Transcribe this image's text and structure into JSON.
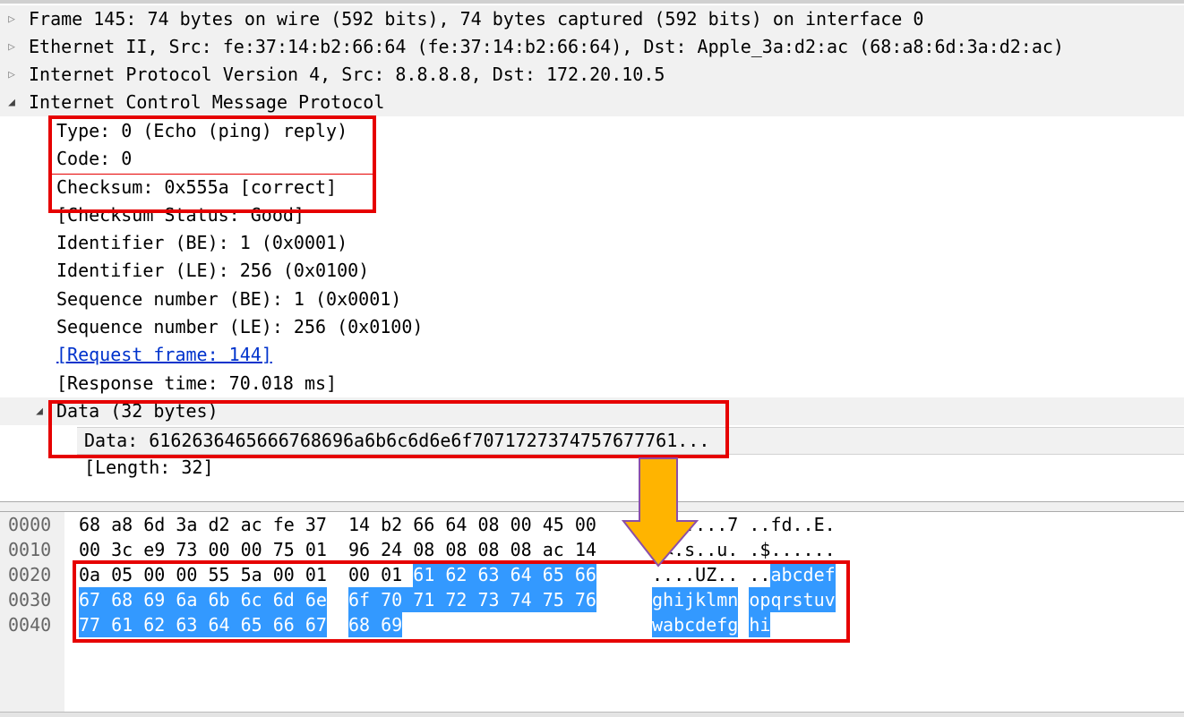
{
  "detail_tree": {
    "frame": "Frame 145: 74 bytes on wire (592 bits), 74 bytes captured (592 bits) on interface 0",
    "ethernet": "Ethernet II, Src: fe:37:14:b2:66:64 (fe:37:14:b2:66:64), Dst: Apple_3a:d2:ac (68:a8:6d:3a:d2:ac)",
    "ip": "Internet Protocol Version 4, Src: 8.8.8.8, Dst: 172.20.10.5",
    "icmp": "Internet Control Message Protocol",
    "type": "Type: 0 (Echo (ping) reply)",
    "code": "Code: 0",
    "checksum": "Checksum: 0x555a [correct]",
    "checksum_status": "[Checksum Status: Good]",
    "id_be": "Identifier (BE): 1 (0x0001)",
    "id_le": "Identifier (LE): 256 (0x0100)",
    "seq_be": "Sequence number (BE): 1 (0x0001)",
    "seq_le": "Sequence number (LE): 256 (0x0100)",
    "request_frame": "[Request frame: 144]",
    "response_time": "[Response time: 70.018 ms]",
    "data_header": "Data (32 bytes)",
    "data_value": "Data: 6162636465666768696a6b6c6d6e6f7071727374757677761...",
    "length": "[Length: 32]"
  },
  "hex_pane": {
    "rows": [
      {
        "offset": "0000",
        "bytes": [
          "68",
          "a8",
          "6d",
          "3a",
          "d2",
          "ac",
          "fe",
          "37",
          "14",
          "b2",
          "66",
          "64",
          "08",
          "00",
          "45",
          "00"
        ],
        "ascii": [
          "h",
          ".",
          "m",
          ":",
          ".",
          ".",
          ".",
          "7",
          ".",
          ".",
          "f",
          "d",
          ".",
          ".",
          "E",
          "."
        ],
        "sel_from": 99
      },
      {
        "offset": "0010",
        "bytes": [
          "00",
          "3c",
          "e9",
          "73",
          "00",
          "00",
          "75",
          "01",
          "96",
          "24",
          "08",
          "08",
          "08",
          "08",
          "ac",
          "14"
        ],
        "ascii": [
          ".",
          "<",
          ".",
          "s",
          ".",
          ".",
          "u",
          ".",
          ".",
          "$",
          ".",
          ".",
          ".",
          ".",
          ".",
          "."
        ],
        "sel_from": 99
      },
      {
        "offset": "0020",
        "bytes": [
          "0a",
          "05",
          "00",
          "00",
          "55",
          "5a",
          "00",
          "01",
          "00",
          "01",
          "61",
          "62",
          "63",
          "64",
          "65",
          "66"
        ],
        "ascii": [
          ".",
          ".",
          ".",
          ".",
          "U",
          "Z",
          ".",
          ".",
          ".",
          ".",
          "a",
          "b",
          "c",
          "d",
          "e",
          "f"
        ],
        "sel_from": 10
      },
      {
        "offset": "0030",
        "bytes": [
          "67",
          "68",
          "69",
          "6a",
          "6b",
          "6c",
          "6d",
          "6e",
          "6f",
          "70",
          "71",
          "72",
          "73",
          "74",
          "75",
          "76"
        ],
        "ascii": [
          "g",
          "h",
          "i",
          "j",
          "k",
          "l",
          "m",
          "n",
          "o",
          "p",
          "q",
          "r",
          "s",
          "t",
          "u",
          "v"
        ],
        "sel_from": 0
      },
      {
        "offset": "0040",
        "bytes": [
          "77",
          "61",
          "62",
          "63",
          "64",
          "65",
          "66",
          "67",
          "68",
          "69"
        ],
        "ascii": [
          "w",
          "a",
          "b",
          "c",
          "d",
          "e",
          "f",
          "g",
          "h",
          "i"
        ],
        "sel_from": 0
      }
    ]
  },
  "colors": {
    "selection": "#3399ff",
    "annotation": "#e60000",
    "arrow": "#ffb400",
    "link": "#0033cc"
  }
}
